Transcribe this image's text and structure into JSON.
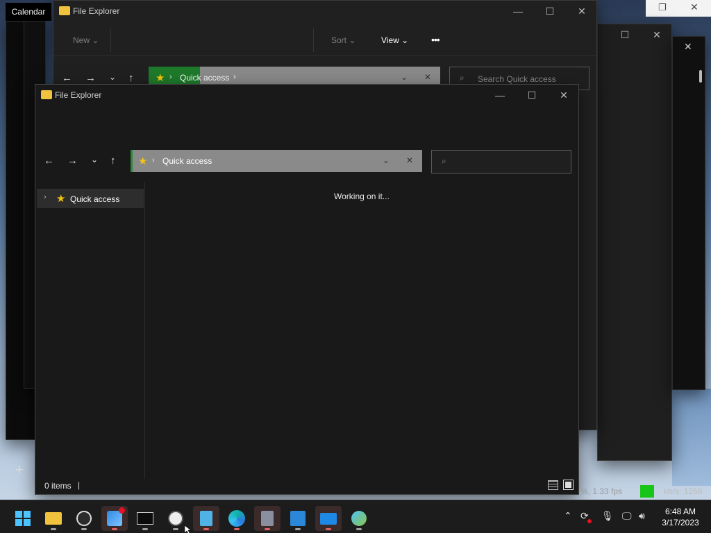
{
  "desktop": {
    "calendar_chip": "Calendar"
  },
  "back_explorer": {
    "title": "File Explorer",
    "commands": {
      "new": "New",
      "sort": "Sort",
      "view": "View",
      "more": "•••"
    },
    "address": {
      "path": "Quick access"
    },
    "search": {
      "placeholder": "Search Quick access"
    }
  },
  "front_explorer": {
    "title": "File Explorer",
    "address": {
      "path": "Quick access"
    },
    "sidebar": {
      "items": [
        {
          "label": "Quick access"
        }
      ]
    },
    "content": {
      "message": "Working on it..."
    },
    "status": {
      "items_text": "0 items"
    }
  },
  "overlay": {
    "fps_text": "%, 1.33 fps",
    "kbs_text": "kb/s: 1258"
  },
  "taskbar": {
    "clock": {
      "time": "6:48 AM",
      "date": "3/17/2023"
    }
  },
  "colors": {
    "accent_yellow": "#f4c40f",
    "status_green": "#19c419",
    "window_bg": "#202020"
  }
}
